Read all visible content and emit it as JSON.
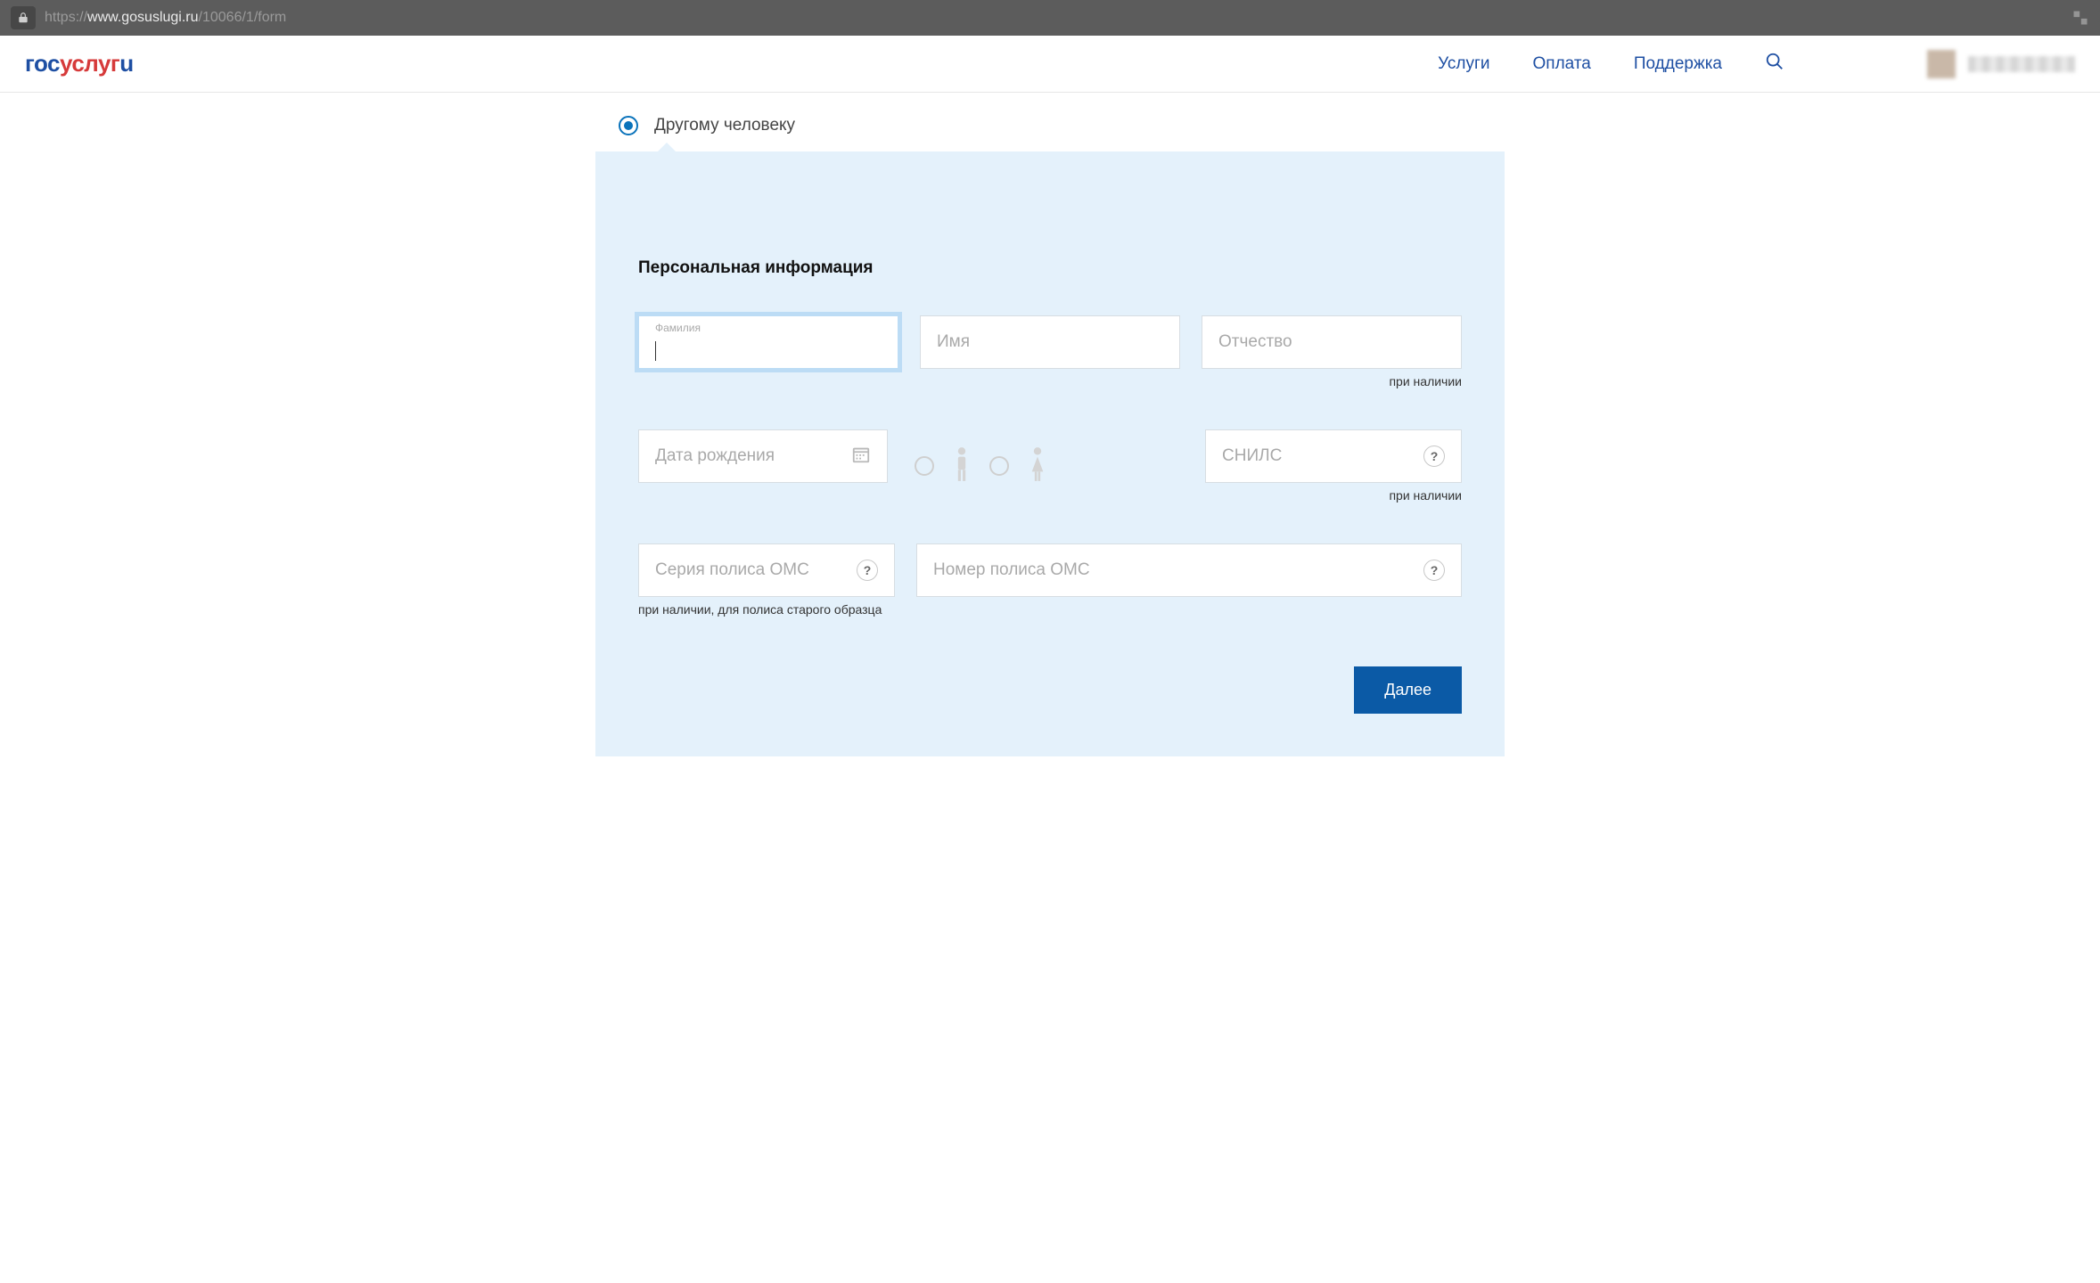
{
  "browser": {
    "url_prefix": "https://",
    "url_host": "www.gosuslugi.ru",
    "url_path": "/10066/1/form"
  },
  "header": {
    "logo_part1": "гос",
    "logo_part2": "услуг",
    "logo_part3": "u",
    "nav": {
      "services": "Услуги",
      "payment": "Оплата",
      "support": "Поддержка"
    }
  },
  "radio": {
    "other_person": "Другому человеку"
  },
  "form": {
    "section_title": "Персональная информация",
    "surname_label": "Фамилия",
    "name_placeholder": "Имя",
    "patronymic_placeholder": "Отчество",
    "patronymic_hint": "при наличии",
    "dob_placeholder": "Дата рождения",
    "snils_placeholder": "СНИЛС",
    "snils_hint": "при наличии",
    "oms_series_placeholder": "Серия полиса ОМС",
    "oms_series_hint": "при наличии, для полиса старого образца",
    "oms_number_placeholder": "Номер полиса ОМС",
    "help_symbol": "?",
    "submit": "Далее"
  }
}
